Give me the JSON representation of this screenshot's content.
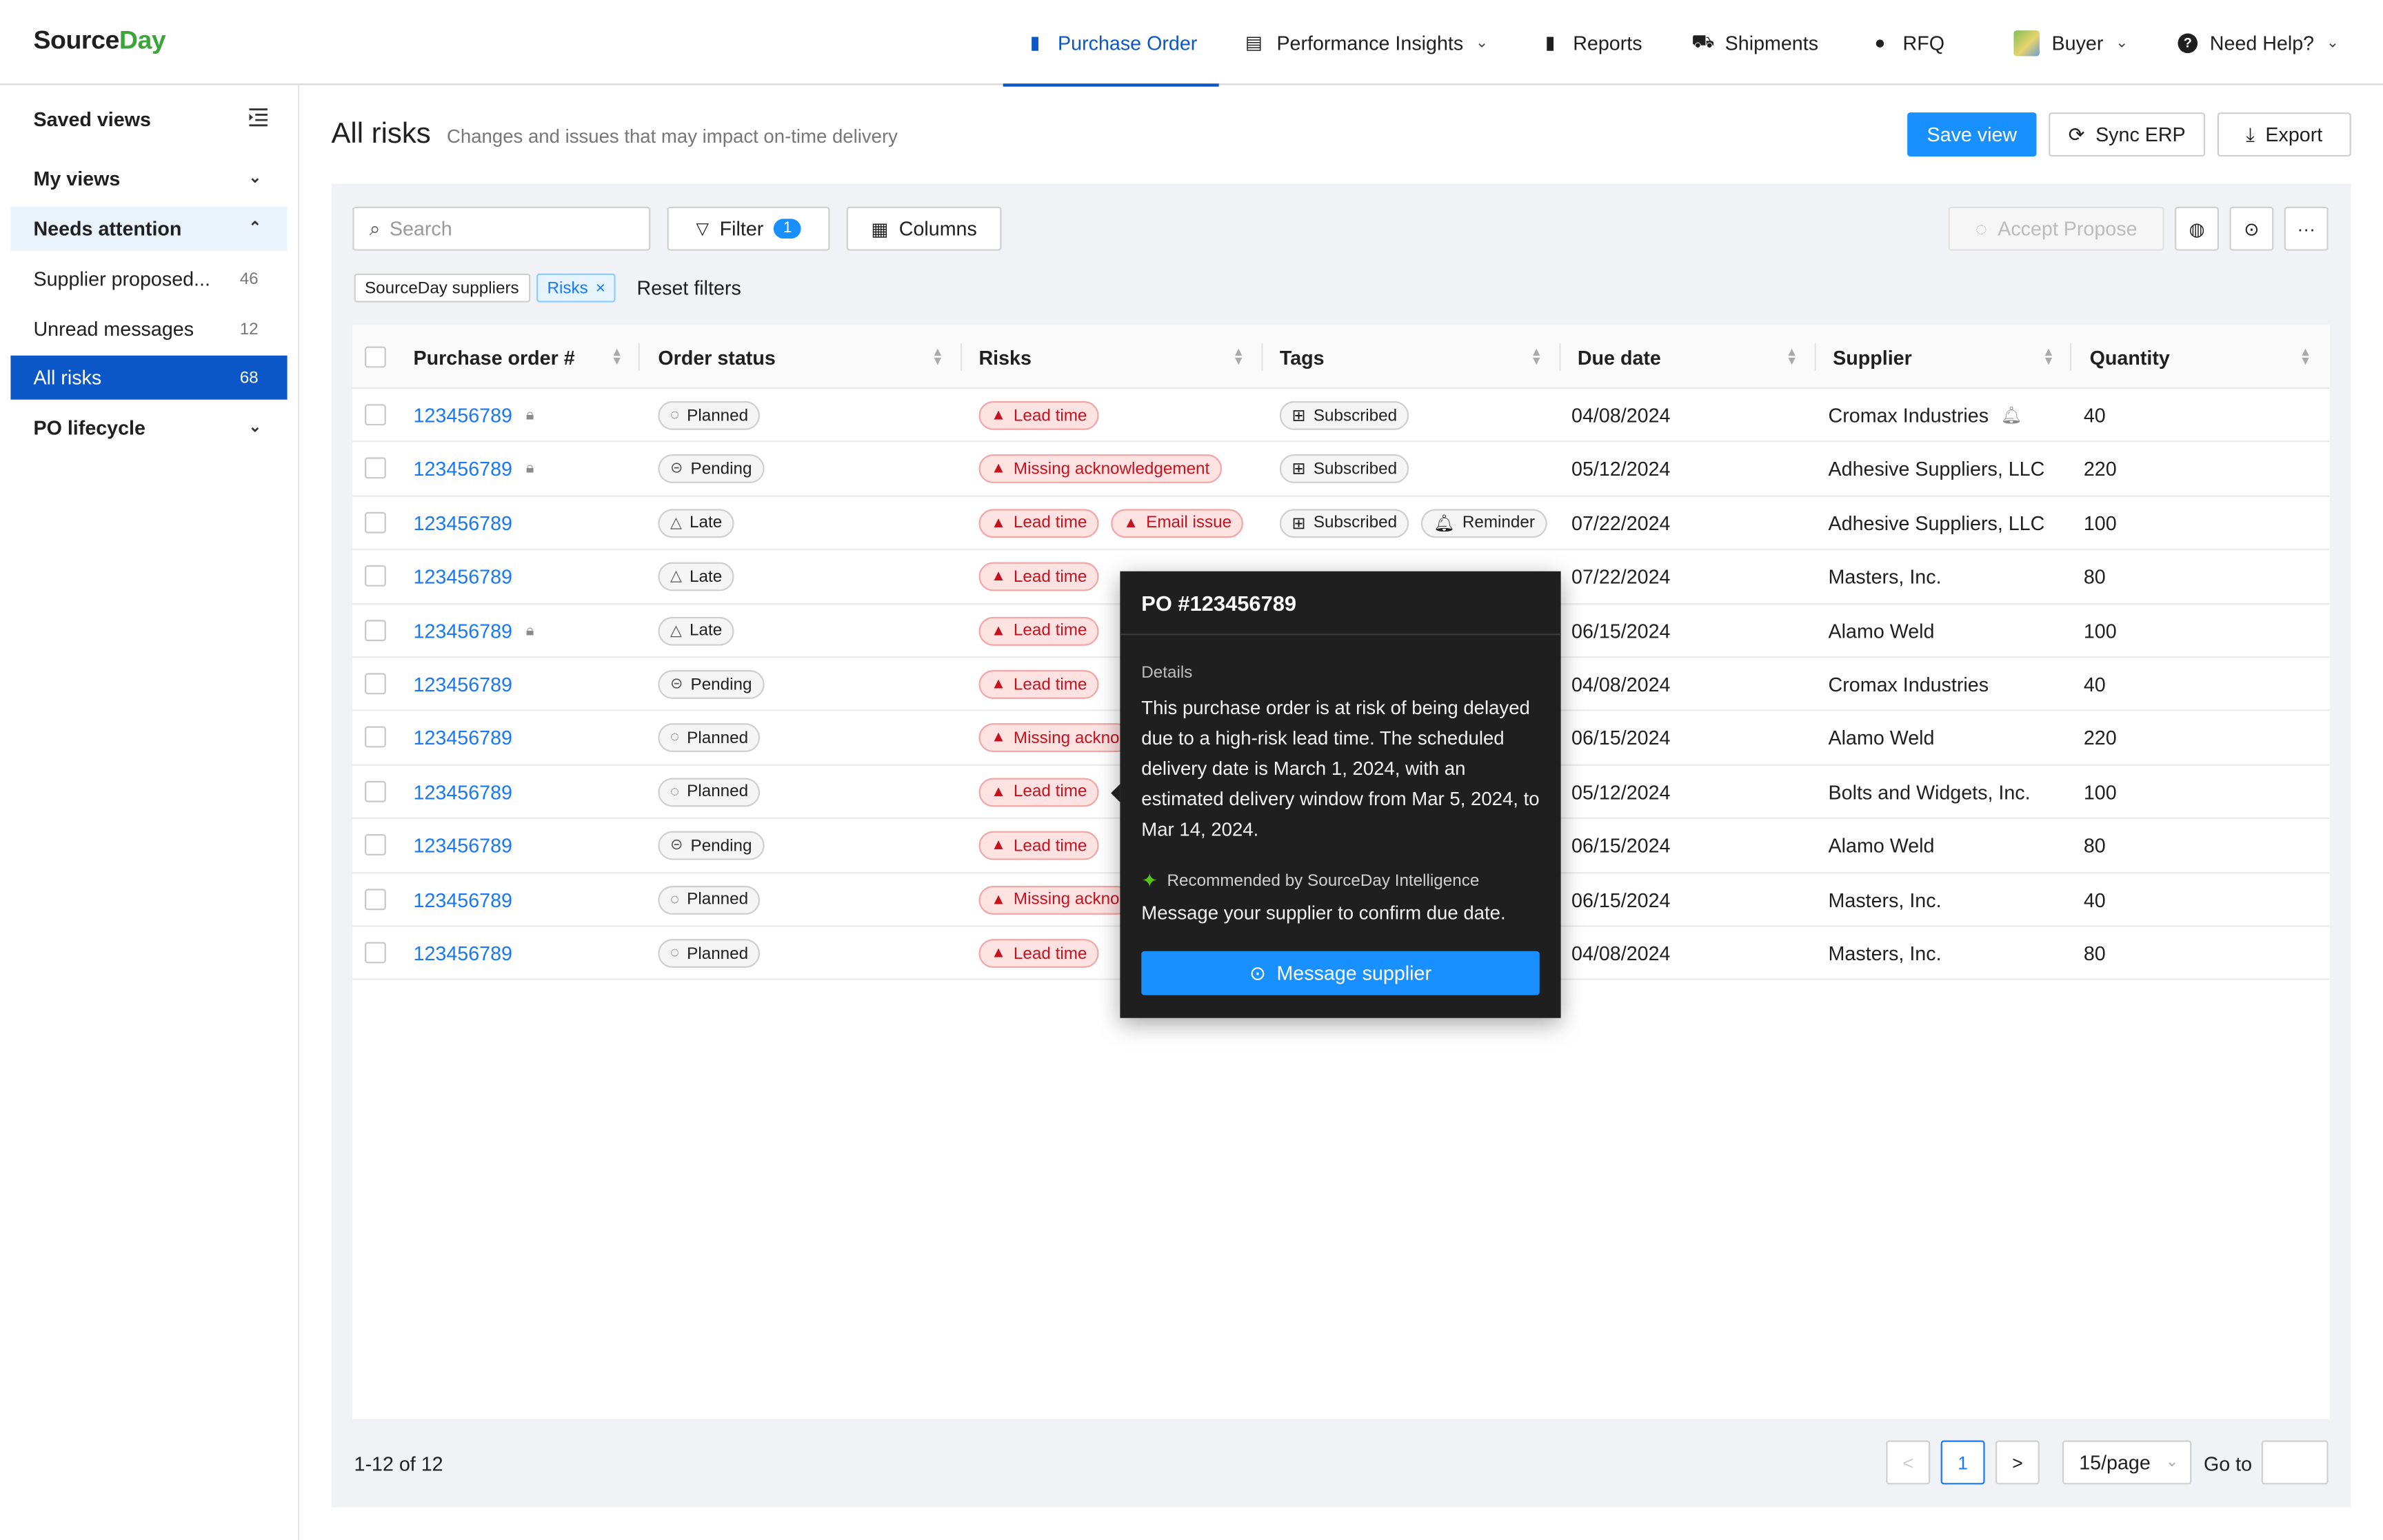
{
  "app": {
    "logo_source": "Source",
    "logo_day": "Day"
  },
  "nav": {
    "items": [
      {
        "label": "Purchase Order",
        "icon": "document-icon",
        "active": true
      },
      {
        "label": "Performance Insights",
        "icon": "chart-doc-icon",
        "dropdown": true
      },
      {
        "label": "Reports",
        "icon": "file-icon"
      },
      {
        "label": "Shipments",
        "icon": "truck-icon"
      },
      {
        "label": "RFQ",
        "icon": "chat-icon"
      },
      {
        "label": "Buyer",
        "icon": "avatar",
        "dropdown": true
      },
      {
        "label": "Need Help?",
        "icon": "help-icon",
        "dropdown": true
      }
    ]
  },
  "sidebar": {
    "title": "Saved views",
    "items": [
      {
        "label": "My views"
      },
      {
        "label": "Needs attention"
      },
      {
        "label": "Supplier proposed...",
        "count": "46"
      },
      {
        "label": "Unread messages",
        "count": "12"
      },
      {
        "label": "All risks",
        "count": "68"
      },
      {
        "label": "PO lifecycle"
      }
    ]
  },
  "header": {
    "title": "All risks",
    "subtitle": "Changes and issues that may impact on-time delivery",
    "save_view": "Save view",
    "sync_erp": "Sync ERP",
    "export": "Export"
  },
  "toolbar": {
    "search_placeholder": "Search",
    "filter": "Filter",
    "filter_count": "1",
    "columns": "Columns",
    "accept_propose": "Accept Propose",
    "more": "···"
  },
  "filters": {
    "chips": [
      "SourceDay suppliers",
      "Risks"
    ],
    "reset": "Reset filters"
  },
  "table": {
    "columns": [
      "Purchase order #",
      "Order status",
      "Risks",
      "Tags",
      "Due date",
      "Supplier",
      "Quantity"
    ],
    "rows": [
      {
        "po": "123456789",
        "locked": true,
        "status": "Planned",
        "risks": [
          "Lead time"
        ],
        "tags": [
          "Subscribed"
        ],
        "due": "04/08/2024",
        "supplier": "Cromax Industries",
        "bell": true,
        "qty": "40"
      },
      {
        "po": "123456789",
        "locked": true,
        "status": "Pending",
        "risks": [
          "Missing acknowledgement"
        ],
        "tags": [
          "Subscribed"
        ],
        "due": "05/12/2024",
        "supplier": "Adhesive Suppliers, LLC",
        "qty": "220"
      },
      {
        "po": "123456789",
        "status": "Late",
        "risks": [
          "Lead time",
          "Email issue"
        ],
        "tags": [
          "Subscribed",
          "Reminder"
        ],
        "due": "07/22/2024",
        "supplier": "Adhesive Suppliers, LLC",
        "qty": "100"
      },
      {
        "po": "123456789",
        "status": "Late",
        "risks": [
          "Lead time"
        ],
        "tags": [],
        "due": "07/22/2024",
        "supplier": "Masters, Inc.",
        "qty": "80"
      },
      {
        "po": "123456789",
        "locked": true,
        "status": "Late",
        "risks": [
          "Lead time"
        ],
        "tags": [],
        "due": "06/15/2024",
        "supplier": "Alamo Weld",
        "qty": "100"
      },
      {
        "po": "123456789",
        "status": "Pending",
        "risks": [
          "Lead time"
        ],
        "tags": [],
        "due": "04/08/2024",
        "supplier": "Cromax Industries",
        "qty": "40"
      },
      {
        "po": "123456789",
        "status": "Planned",
        "risks": [
          "Missing ackno"
        ],
        "tags": [],
        "due": "06/15/2024",
        "supplier": "Alamo Weld",
        "qty": "220"
      },
      {
        "po": "123456789",
        "status": "Planned",
        "risks": [
          "Lead time"
        ],
        "tags": [],
        "due": "05/12/2024",
        "supplier": "Bolts and Widgets, Inc.",
        "qty": "100"
      },
      {
        "po": "123456789",
        "status": "Pending",
        "risks": [
          "Lead time"
        ],
        "tags": [],
        "due": "06/15/2024",
        "supplier": "Alamo Weld",
        "qty": "80"
      },
      {
        "po": "123456789",
        "status": "Planned",
        "risks": [
          "Missing ackno"
        ],
        "tags": [],
        "due": "06/15/2024",
        "supplier": "Masters, Inc.",
        "qty": "40"
      },
      {
        "po": "123456789",
        "status": "Planned",
        "risks": [
          "Lead time"
        ],
        "tags": [],
        "due": "04/08/2024",
        "supplier": "Masters, Inc.",
        "qty": "80"
      }
    ]
  },
  "pagination": {
    "info": "1-12 of 12",
    "prev": "<",
    "current": "1",
    "next": ">",
    "page_size": "15/page",
    "goto": "Go to"
  },
  "tooltip": {
    "title": "PO #123456789",
    "details_label": "Details",
    "body": "This purchase order is at risk of being delayed due to a high-risk lead time. The scheduled delivery date is March 1, 2024, with an estimated delivery window from Mar 5, 2024, to Mar 14, 2024.",
    "recommended": "Recommended by SourceDay Intelligence",
    "message": "Message your supplier to confirm due date.",
    "button": "Message supplier"
  },
  "colors": {
    "brand_blue": "#0b57c8",
    "primary": "#1890ff",
    "risk_red": "#c4121f",
    "logo_green": "#3aa63a"
  }
}
